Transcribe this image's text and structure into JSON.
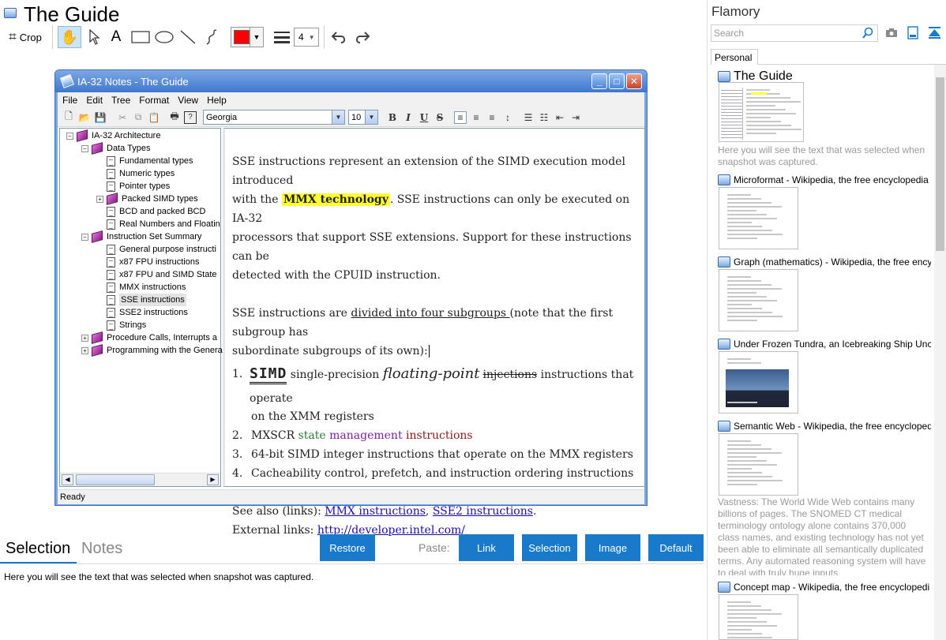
{
  "app": {
    "title": "The Guide"
  },
  "toolbar": {
    "crop_label": "Crop",
    "line_width_value": "4",
    "color": "#ff0000"
  },
  "window": {
    "title": "IA-32 Notes - The Guide",
    "menu": [
      "File",
      "Edit",
      "Tree",
      "Format",
      "View",
      "Help"
    ],
    "font_name": "Georgia",
    "font_size": "10",
    "status": "Ready",
    "controls": [
      "_",
      "□",
      "✕"
    ]
  },
  "tree": [
    {
      "label": "IA-32 Architecture",
      "type": "book",
      "expander": "−"
    },
    {
      "label": "Data Types",
      "type": "book",
      "expander": "−"
    },
    {
      "label": "Fundamental types",
      "type": "page"
    },
    {
      "label": "Numeric types",
      "type": "page"
    },
    {
      "label": "Pointer types",
      "type": "page"
    },
    {
      "label": "Packed SIMD types",
      "type": "book",
      "expander": "+"
    },
    {
      "label": "BCD and packed BCD",
      "type": "page"
    },
    {
      "label": "Real Numbers and Floatin",
      "type": "page"
    },
    {
      "label": "Instruction Set Summary",
      "type": "book",
      "expander": "−"
    },
    {
      "label": "General purpose instructi",
      "type": "page"
    },
    {
      "label": "x87 FPU instructions",
      "type": "page"
    },
    {
      "label": "x87 FPU and SIMD State",
      "type": "page"
    },
    {
      "label": "MMX instructions",
      "type": "page"
    },
    {
      "label": "SSE instructions",
      "type": "page",
      "selected": true
    },
    {
      "label": "SSE2 instructions",
      "type": "page"
    },
    {
      "label": "Strings",
      "type": "page"
    },
    {
      "label": "Procedure Calls, Interrupts a",
      "type": "book",
      "expander": "+"
    },
    {
      "label": "Programming with the Genera",
      "type": "book",
      "expander": "+"
    }
  ],
  "doc": {
    "p1_a": "SSE instructions represent an extension of the SIMD execution model introduced",
    "p1_b": "with the ",
    "p1_hl": "MMX technology",
    "p1_c": ". SSE instructions can only be executed on IA-32",
    "p1_d": "processors that support SSE extensions. Support for these instructions can be",
    "p1_e": "detected with the CPUID instruction.",
    "p2_a": "SSE instructions are ",
    "p2_link": "divided into four subgroups ",
    "p2_b": "(note that the first subgroup has",
    "p2_c": "subordinate subgroups of its own):",
    "li1_num": "1.",
    "li1_simd": "SIMD",
    "li1_a": " single-precision ",
    "li1_fp": "floating-point",
    "li1_strike": "injections",
    "li1_b": " instructions that operate",
    "li1_c": "on the XMM registers",
    "li2_num": "2.",
    "li2_a": "MXSCR ",
    "li2_state": "state",
    "li2_mgmt": " management",
    "li2_instr": " instructions",
    "li3_num": "3.",
    "li3": "64-bit SIMD integer instructions that operate on the MMX registers",
    "li4_num": "4.",
    "li4": "Cacheability control, prefetch, and instruction ordering instructions",
    "see_also": "See also (links): ",
    "see_link1": "MMX instructions",
    "see_comma": ", ",
    "see_link2": "SSE2 instructions",
    "see_dot": ".",
    "ext": "External links: ",
    "ext_link": "http://developer.intel.com/"
  },
  "bottom": {
    "tab_selection": "Selection",
    "tab_notes": "Notes",
    "restore": "Restore",
    "paste_label": "Paste:",
    "link": "Link",
    "selection": "Selection",
    "image": "Image",
    "default": "Default",
    "selection_text": "Here you will see the text that was selected when snapshot was captured."
  },
  "panel": {
    "title": "Flamory",
    "search_placeholder": "Search",
    "tab": "Personal",
    "snapshots": [
      {
        "title": "The Guide",
        "note": "Here you will see the text that was selected when snapshot was captured."
      },
      {
        "title": "Microformat - Wikipedia, the free encyclopedia"
      },
      {
        "title": "Graph (mathematics) - Wikipedia, the free ency"
      },
      {
        "title": "Under Frozen Tundra, an Icebreaking Ship Unco"
      },
      {
        "title": "Semantic Web - Wikipedia, the free encycloped",
        "note": "Vastness: The World Wide Web contains many billions of pages. The SNOMED CT medical terminology ontology alone contains 370,000 class names, and existing technology has not yet been able to eliminate all semantically duplicated terms. Any automated reasoning system will have to deal with truly huge inputs."
      },
      {
        "title": "Concept map - Wikipedia, the free encyclopedi"
      }
    ]
  },
  "colors": {
    "accent": "#1979ca",
    "highlight": "#ffff33",
    "state_green": "#2e7d32",
    "mgmt_purple": "#7b1fa2",
    "instr_maroon": "#8b1a1a"
  }
}
